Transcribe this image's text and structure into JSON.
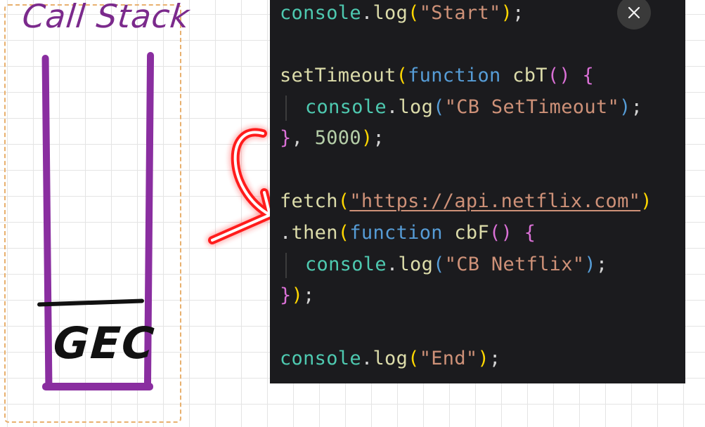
{
  "whiteboard": {
    "title": "Call Stack",
    "frame_label": "GEC"
  },
  "code": {
    "line1": {
      "obj": "console",
      "dot": ".",
      "fn": "log",
      "open": "(",
      "str": "\"Start\"",
      "close": ")",
      "end": ";"
    },
    "line2": {
      "fn": "setTimeout",
      "open": "(",
      "kw": "function",
      "name": " cbT",
      "parens": "()",
      "brace": " {"
    },
    "line3": {
      "obj": "console",
      "dot": ".",
      "fn": "log",
      "open": "(",
      "str": "\"CB SetTimeout\"",
      "close": ")",
      "end": ";"
    },
    "line4": {
      "brace": "}",
      "comma": ", ",
      "num": "5000",
      "close": ")",
      "end": ";"
    },
    "line5": {
      "fn": "fetch",
      "open": "(",
      "url": "\"https://api.netflix.com\"",
      "close": ")"
    },
    "line6": {
      "dot": ".",
      "fn": "then",
      "open": "(",
      "kw": "function",
      "name": " cbF",
      "parens": "()",
      "brace": " {"
    },
    "line7": {
      "obj": "console",
      "dot": ".",
      "fn": "log",
      "open": "(",
      "str": "\"CB Netflix\"",
      "close": ")",
      "end": ";"
    },
    "line8": {
      "brace": "}",
      "close": ")",
      "end": ";"
    },
    "line9": {
      "obj": "console",
      "dot": ".",
      "fn": "log",
      "open": "(",
      "str": "\"End\"",
      "close": ")",
      "end": ";"
    }
  },
  "controls": {
    "close_icon": "close-icon"
  },
  "colors": {
    "stack_purple": "#8a2ea0",
    "title_purple": "#7b2a8c",
    "arrow_red": "#ff1a1a",
    "dash_orange": "#e8b06e",
    "panel_bg": "#1b1b1e"
  }
}
